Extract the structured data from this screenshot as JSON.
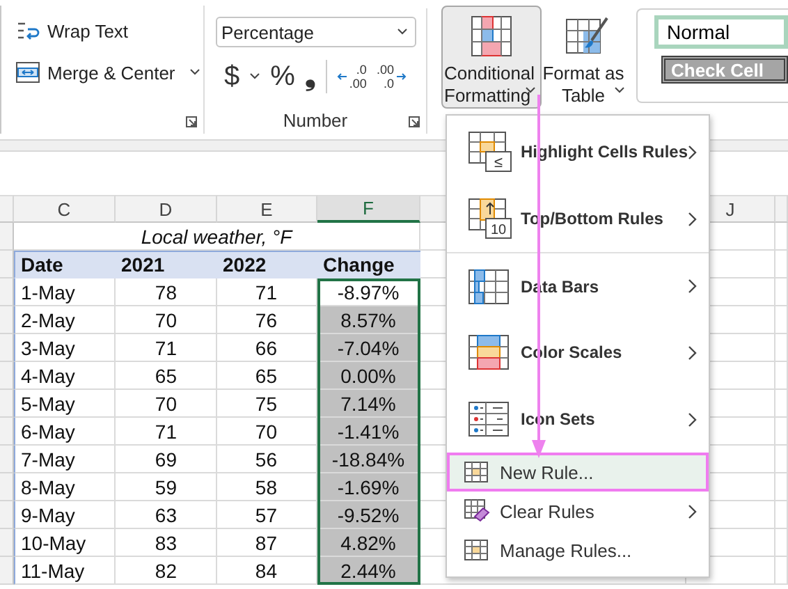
{
  "ribbon": {
    "alignment": {
      "wrap_text": "Wrap Text",
      "merge_center": "Merge & Center"
    },
    "number": {
      "format": "Percentage",
      "currency": "$",
      "percent": "%",
      "comma": "❟",
      "decimals": [
        {
          "kind": "increase",
          "upper": ".0",
          "lower": ".00"
        },
        {
          "kind": "decrease",
          "upper": ".00",
          "lower": ".0"
        }
      ],
      "group_label": "Number"
    },
    "buttons": [
      {
        "kind": "conditional",
        "label": "Conditional Formatting",
        "selected": true
      },
      {
        "kind": "table",
        "label": "Format as Table",
        "selected": false
      }
    ],
    "styles": [
      {
        "kind": "normal",
        "label": "Normal"
      },
      {
        "kind": "check",
        "label": "Check Cell"
      }
    ]
  },
  "sheet": {
    "columns": [
      {
        "label": "C",
        "selected": false
      },
      {
        "label": "D",
        "selected": false
      },
      {
        "label": "E",
        "selected": false
      },
      {
        "label": "F",
        "selected": true
      },
      {
        "label": "J",
        "selected": false
      }
    ],
    "title": "Local weather, °F",
    "headers": [
      "Date",
      "2021",
      "2022",
      "Change"
    ],
    "rows": [
      {
        "date": "1-May",
        "y2021": "78",
        "y2022": "71",
        "change": "-8.97%",
        "highlighted": false
      },
      {
        "date": "2-May",
        "y2021": "70",
        "y2022": "76",
        "change": "8.57%",
        "highlighted": true
      },
      {
        "date": "3-May",
        "y2021": "71",
        "y2022": "66",
        "change": "-7.04%",
        "highlighted": true
      },
      {
        "date": "4-May",
        "y2021": "65",
        "y2022": "65",
        "change": "0.00%",
        "highlighted": true
      },
      {
        "date": "5-May",
        "y2021": "70",
        "y2022": "75",
        "change": "7.14%",
        "highlighted": true
      },
      {
        "date": "6-May",
        "y2021": "71",
        "y2022": "70",
        "change": "-1.41%",
        "highlighted": true
      },
      {
        "date": "7-May",
        "y2021": "69",
        "y2022": "56",
        "change": "-18.84%",
        "highlighted": true
      },
      {
        "date": "8-May",
        "y2021": "59",
        "y2022": "58",
        "change": "-1.69%",
        "highlighted": true
      },
      {
        "date": "9-May",
        "y2021": "63",
        "y2022": "57",
        "change": "-9.52%",
        "highlighted": true
      },
      {
        "date": "10-May",
        "y2021": "83",
        "y2022": "87",
        "change": "4.82%",
        "highlighted": true
      },
      {
        "date": "11-May",
        "y2021": "82",
        "y2022": "84",
        "change": "2.44%",
        "highlighted": true
      }
    ]
  },
  "menu": {
    "items": [
      {
        "kind": "large",
        "label": "Highlight Cells Rules",
        "badge": "≤",
        "submenu": true,
        "divider_above": false,
        "selected": false
      },
      {
        "kind": "large",
        "label": "Top/Bottom Rules",
        "badge": "10",
        "submenu": true,
        "divider_above": false,
        "selected": false
      },
      {
        "kind": "large",
        "label": "Data Bars",
        "submenu": true,
        "divider_above": true,
        "selected": false
      },
      {
        "kind": "large",
        "label": "Color Scales",
        "submenu": true,
        "divider_above": false,
        "selected": false
      },
      {
        "kind": "large",
        "label": "Icon Sets",
        "submenu": true,
        "divider_above": false,
        "selected": false
      },
      {
        "kind": "small",
        "label": "New Rule...",
        "submenu": false,
        "divider_above": false,
        "selected": true
      },
      {
        "kind": "small",
        "label": "Clear Rules",
        "submenu": true,
        "divider_above": false,
        "selected": false
      },
      {
        "kind": "small",
        "label": "Manage Rules...",
        "submenu": false,
        "divider_above": false,
        "selected": false
      }
    ]
  }
}
